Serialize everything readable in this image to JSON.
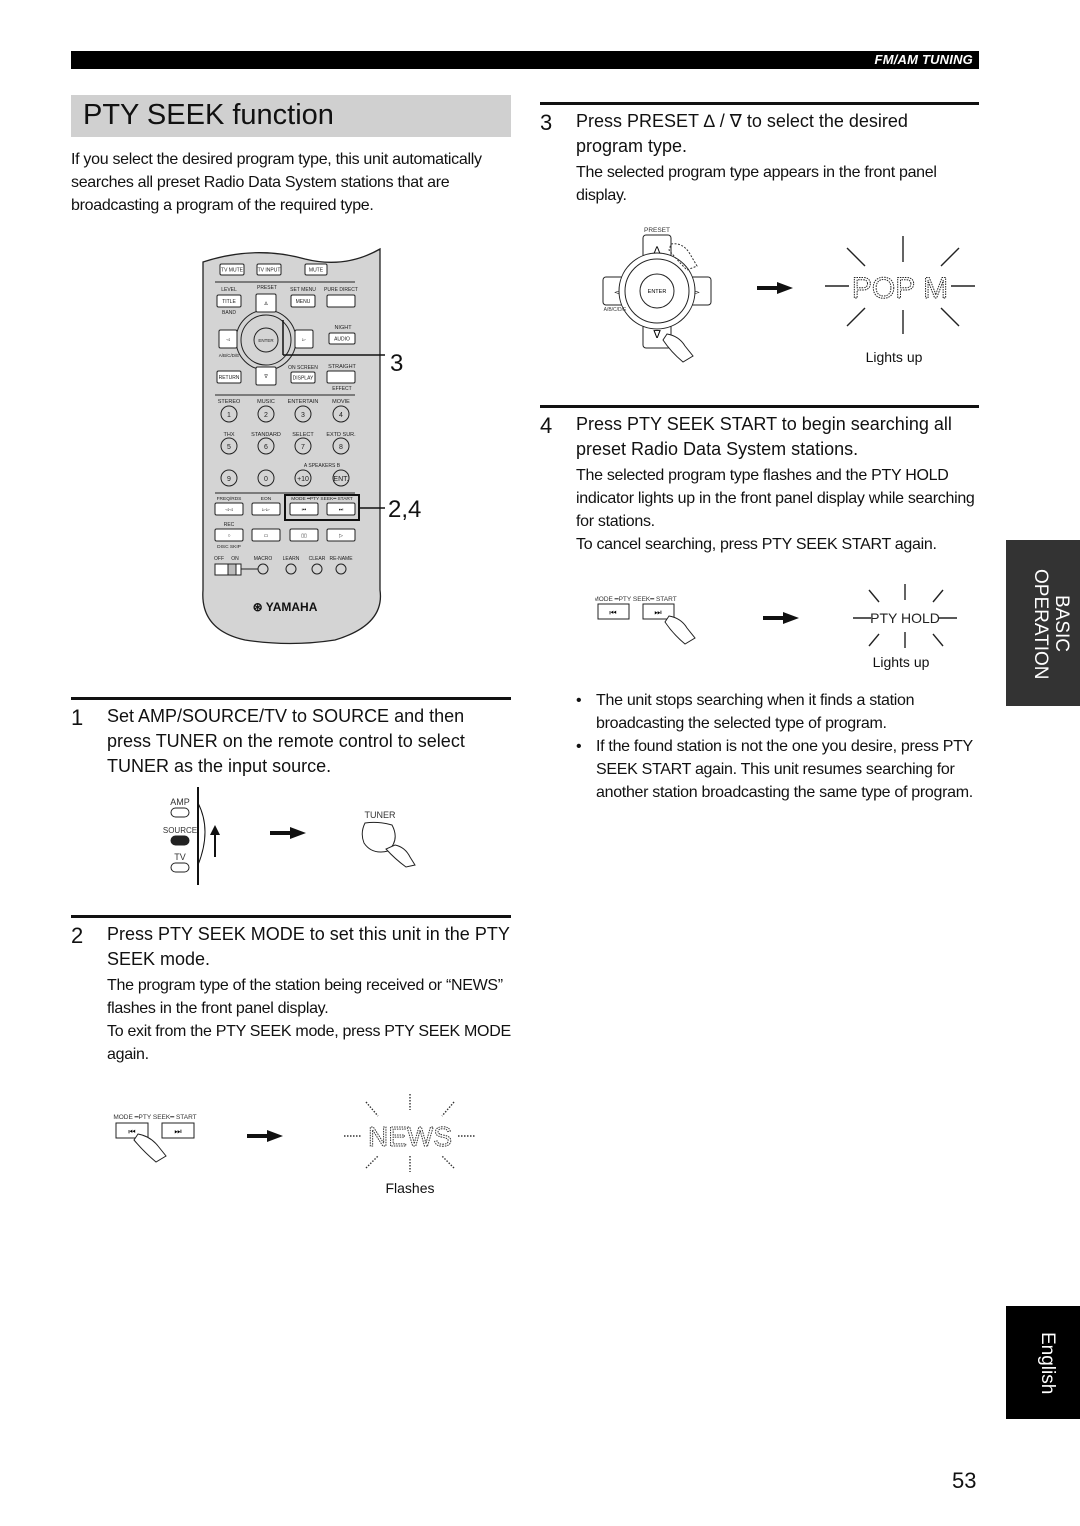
{
  "header": {
    "section_label": "FM/AM TUNING"
  },
  "title": "PTY SEEK function",
  "intro": "If you select the desired program type, this unit automatically searches all preset Radio Data System stations that are broadcasting a program of the required type.",
  "remote": {
    "brand": "YAMAHA",
    "callout_top": "3",
    "callout_bottom": "2,4",
    "row1": [
      "TV MUTE",
      "TV INPUT",
      "MUTE"
    ],
    "row2_labels": [
      "LEVEL",
      "PRESET",
      "SET MENU",
      "PURE DIRECT"
    ],
    "title_btn": "TITLE",
    "menu_btn": "MENU",
    "band_label": "BAND",
    "night_label": "NIGHT",
    "audio_btn": "AUDIO",
    "enter_btn": "ENTER",
    "abcde_label": "A/B/C/D/E",
    "return_btn": "RETURN",
    "on_screen_label": "ON SCREEN",
    "display_btn": "DISPLAY",
    "straight_label": "STRAIGHT",
    "effect_label": "EFFECT",
    "num_labels1": [
      "STEREO",
      "MUSIC",
      "ENTERTAIN",
      "MOVIE"
    ],
    "nums1": [
      "1",
      "2",
      "3",
      "4"
    ],
    "num_labels2": [
      "THX",
      "STANDARD",
      "SELECT",
      "EXTD SUR."
    ],
    "nums2": [
      "5",
      "6",
      "7",
      "8"
    ],
    "speakers_label": "A  SPEAKERS  B",
    "nums3": [
      "9",
      "0",
      "+10",
      "ENT."
    ],
    "transport_labels": [
      "FREQ/RDS",
      "EON",
      "MODE ━PTY SEEK━ START"
    ],
    "rec_label": "REC",
    "disc_skip_label": "DISC SKIP",
    "bottom_labels": [
      "OFF",
      "ON",
      "MACRO",
      "LEARN",
      "CLEAR",
      "RE-NAME"
    ]
  },
  "steps": [
    {
      "number": "1",
      "heading": "Set AMP/SOURCE/TV to SOURCE and then press TUNER on the remote control to select TUNER as the input source.",
      "body": [],
      "figure": {
        "switch_labels": [
          "AMP",
          "SOURCE",
          "TV"
        ],
        "button_label": "TUNER"
      }
    },
    {
      "number": "2",
      "heading": "Press PTY SEEK MODE to  set this unit in the PTY SEEK mode.",
      "body": [
        "The program type of the station being received or “NEWS” flashes in the front panel display.",
        "To exit from the PTY SEEK mode, press PTY SEEK MODE again."
      ],
      "figure": {
        "button_label": "MODE ━PTY SEEK━ START",
        "display_text": "NEWS",
        "caption": "Flashes"
      }
    },
    {
      "number": "3",
      "heading_prefix": "Press PRESET",
      "heading_symbols": "∆ / ∇",
      "heading_suffix": "to select the desired program type.",
      "body": [
        "The selected program type appears in the front panel display."
      ],
      "figure": {
        "preset_label": "PRESET",
        "enter_label": "ENTER",
        "abcde_label": "A/B/C/D/E",
        "display_text": "POP M",
        "caption": "Lights up"
      }
    },
    {
      "number": "4",
      "heading": "Press PTY SEEK START to begin searching all preset Radio Data System stations.",
      "body": [
        "The selected program type flashes and the PTY HOLD indicator lights up in the front panel display while searching for stations.",
        "To cancel searching, press PTY SEEK START again."
      ],
      "figure": {
        "button_label": "MODE ━PTY SEEK━ START",
        "display_text": "PTY HOLD",
        "caption": "Lights up"
      }
    }
  ],
  "notes": [
    "The unit stops searching when it finds a station broadcasting the selected type of program.",
    "If the found station is not the one you desire, press PTY SEEK START again. This unit resumes searching for another station broadcasting the same type of program."
  ],
  "side_tabs": {
    "section": [
      "BASIC",
      "OPERATION"
    ],
    "language": "English"
  },
  "page_number": "53"
}
